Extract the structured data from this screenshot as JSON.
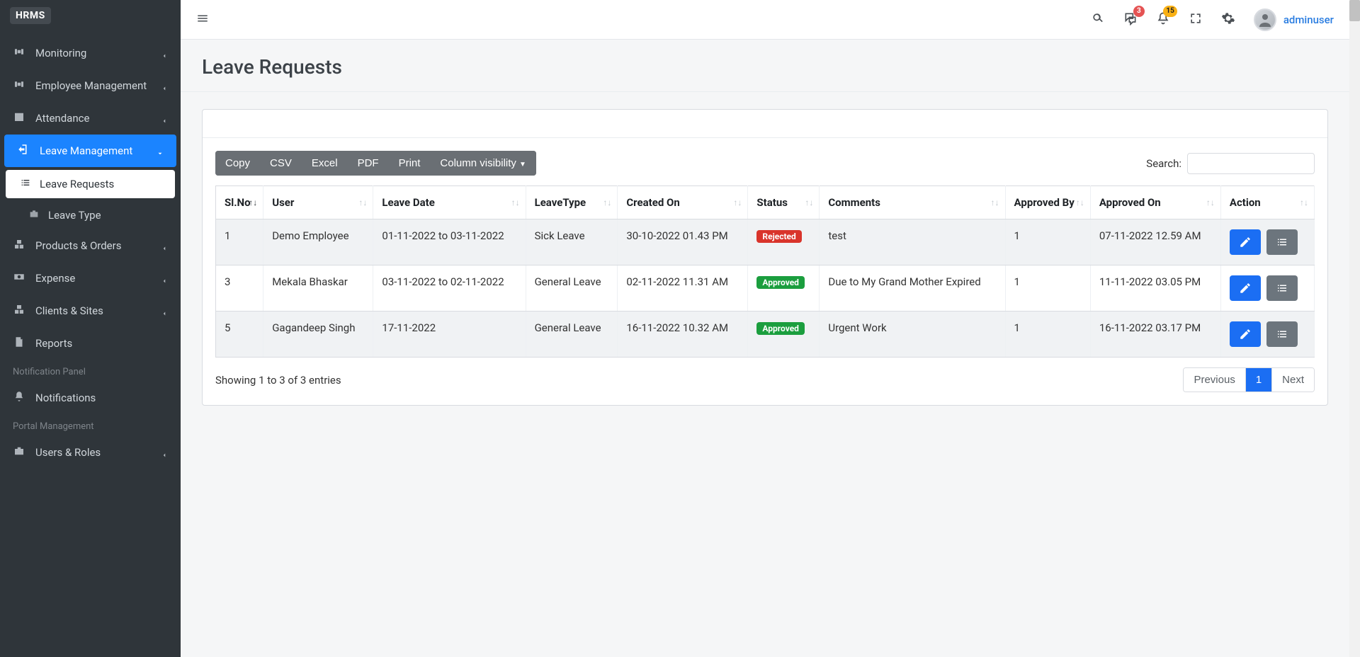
{
  "brand": "HRMS",
  "sidebar": {
    "items": [
      {
        "label": "Monitoring"
      },
      {
        "label": "Employee Management"
      },
      {
        "label": "Attendance"
      },
      {
        "label": "Leave Management",
        "active": true
      },
      {
        "label": "Leave Requests",
        "sub": true,
        "active": true
      },
      {
        "label": "Leave Type",
        "sub": true
      },
      {
        "label": "Products & Orders"
      },
      {
        "label": "Expense"
      },
      {
        "label": "Clients & Sites"
      },
      {
        "label": "Reports",
        "nocaret": true
      }
    ],
    "section_notif": "Notification Panel",
    "notifications_label": "Notifications",
    "section_portal": "Portal Management",
    "users_roles_label": "Users & Roles"
  },
  "topbar": {
    "username": "adminuser",
    "badges": {
      "messages": "3",
      "alerts": "15"
    }
  },
  "page": {
    "title": "Leave Requests"
  },
  "toolbar": {
    "copy": "Copy",
    "csv": "CSV",
    "excel": "Excel",
    "pdf": "PDF",
    "print": "Print",
    "colvis": "Column visibility",
    "search_label": "Search:",
    "search_value": ""
  },
  "table": {
    "columns": [
      "Sl.No",
      "User",
      "Leave Date",
      "LeaveType",
      "Created On",
      "Status",
      "Comments",
      "Approved By",
      "Approved On",
      "Action"
    ],
    "rows": [
      {
        "slno": "1",
        "user": "Demo Employee",
        "leave_date": "01-11-2022 to 03-11-2022",
        "leave_type": "Sick Leave",
        "created_on": "30-10-2022 01.43 PM",
        "status": "Rejected",
        "comments": "test",
        "approved_by": "1",
        "approved_on": "07-11-2022 12.59 AM"
      },
      {
        "slno": "3",
        "user": "Mekala Bhaskar",
        "leave_date": "03-11-2022 to 02-11-2022",
        "leave_type": "General Leave",
        "created_on": "02-11-2022 11.31 AM",
        "status": "Approved",
        "comments": "Due to My Grand Mother Expired",
        "approved_by": "1",
        "approved_on": "11-11-2022 03.05 PM"
      },
      {
        "slno": "5",
        "user": "Gagandeep Singh",
        "leave_date": "17-11-2022",
        "leave_type": "General Leave",
        "created_on": "16-11-2022 10.32 AM",
        "status": "Approved",
        "comments": "Urgent Work",
        "approved_by": "1",
        "approved_on": "16-11-2022 03.17 PM"
      }
    ],
    "info": "Showing 1 to 3 of 3 entries",
    "pager": {
      "prev": "Previous",
      "next": "Next",
      "current": "1"
    }
  }
}
